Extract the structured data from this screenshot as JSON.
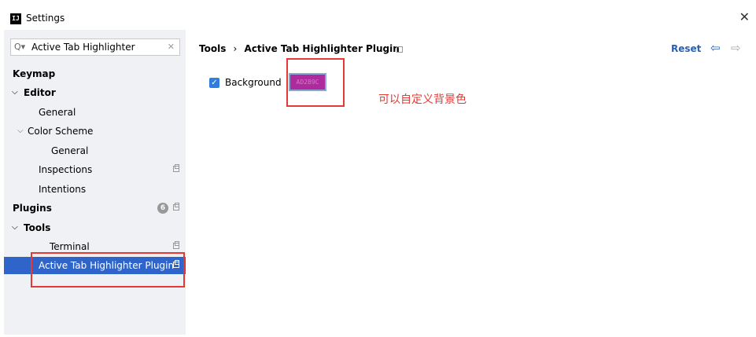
{
  "window": {
    "title": "Settings",
    "logo_text": "IJ",
    "close_glyph": "✕"
  },
  "search": {
    "icon": "search-icon",
    "icon_glyph": "Q▾",
    "value": "Active Tab Highlighter",
    "clear_glyph": "✕"
  },
  "sidebar": {
    "keymap": "Keymap",
    "editor": "Editor",
    "general": "General",
    "color_scheme": "Color Scheme",
    "color_scheme_general": "General",
    "inspections": "Inspections",
    "intentions": "Intentions",
    "plugins": "Plugins",
    "plugins_badge": "6",
    "tools": "Tools",
    "terminal": "Terminal",
    "active_tab_plugin": "Active Tab Highlighter Plugin",
    "chevron_glyph": "⌵"
  },
  "content": {
    "breadcrumb_root": "Tools",
    "breadcrumb_sep": "›",
    "breadcrumb_page": "Active Tab Highlighter Plugin",
    "reset": "Reset",
    "back_glyph": "⇦",
    "forward_glyph": "⇨",
    "background_label": "Background",
    "background_checked_glyph": "✓",
    "background_color_hex": "AD2B9C",
    "annotation": "可以自定义背景色"
  },
  "colors": {
    "accent": "#2f65ca",
    "annotation": "#e53935",
    "swatch": "#AD2B9C"
  }
}
